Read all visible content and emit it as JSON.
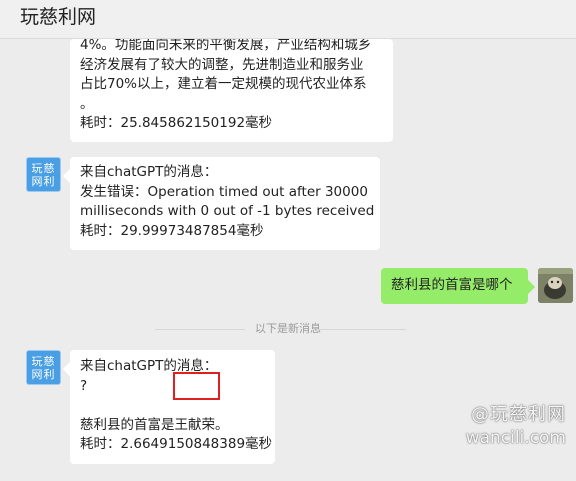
{
  "window": {
    "title": "玩慈利网"
  },
  "messages": {
    "m1": {
      "lines": [
        "4%。功能面向未来的平衡发展，产业结构和城乡",
        "经济发展有了较大的调整，先进制造业和服务业",
        "占比70%以上，建立着一定规模的现代农业体系",
        "。",
        "耗时：25.845862150192毫秒"
      ]
    },
    "m2": {
      "lines": [
        "来自chatGPT的消息：",
        "发生错误：Operation timed out after 30000",
        "milliseconds with 0 out of -1 bytes received",
        "耗时：29.99973487854毫秒"
      ]
    },
    "m3": {
      "text": "慈利县的首富是哪个"
    },
    "m4": {
      "lines": [
        "来自chatGPT的消息：",
        "?",
        "",
        "慈利县的首富是王献荣。",
        "耗时：2.6649150848389毫秒"
      ]
    }
  },
  "divider": {
    "label": "以下是新消息"
  },
  "bot_avatar": {
    "text_top": "玩慈",
    "text_bottom": "网利"
  },
  "watermark": {
    "line1": "@玩慈利网",
    "line2": "wancili.com"
  },
  "colors": {
    "user_bubble": "#95ec69",
    "bot_bubble": "#ffffff",
    "highlight_box": "#e02020",
    "avatar_bg": "#4a9fe4"
  },
  "icons": {
    "bot_avatar": "wancili-logo-avatar",
    "user_avatar": "user-photo-avatar"
  }
}
